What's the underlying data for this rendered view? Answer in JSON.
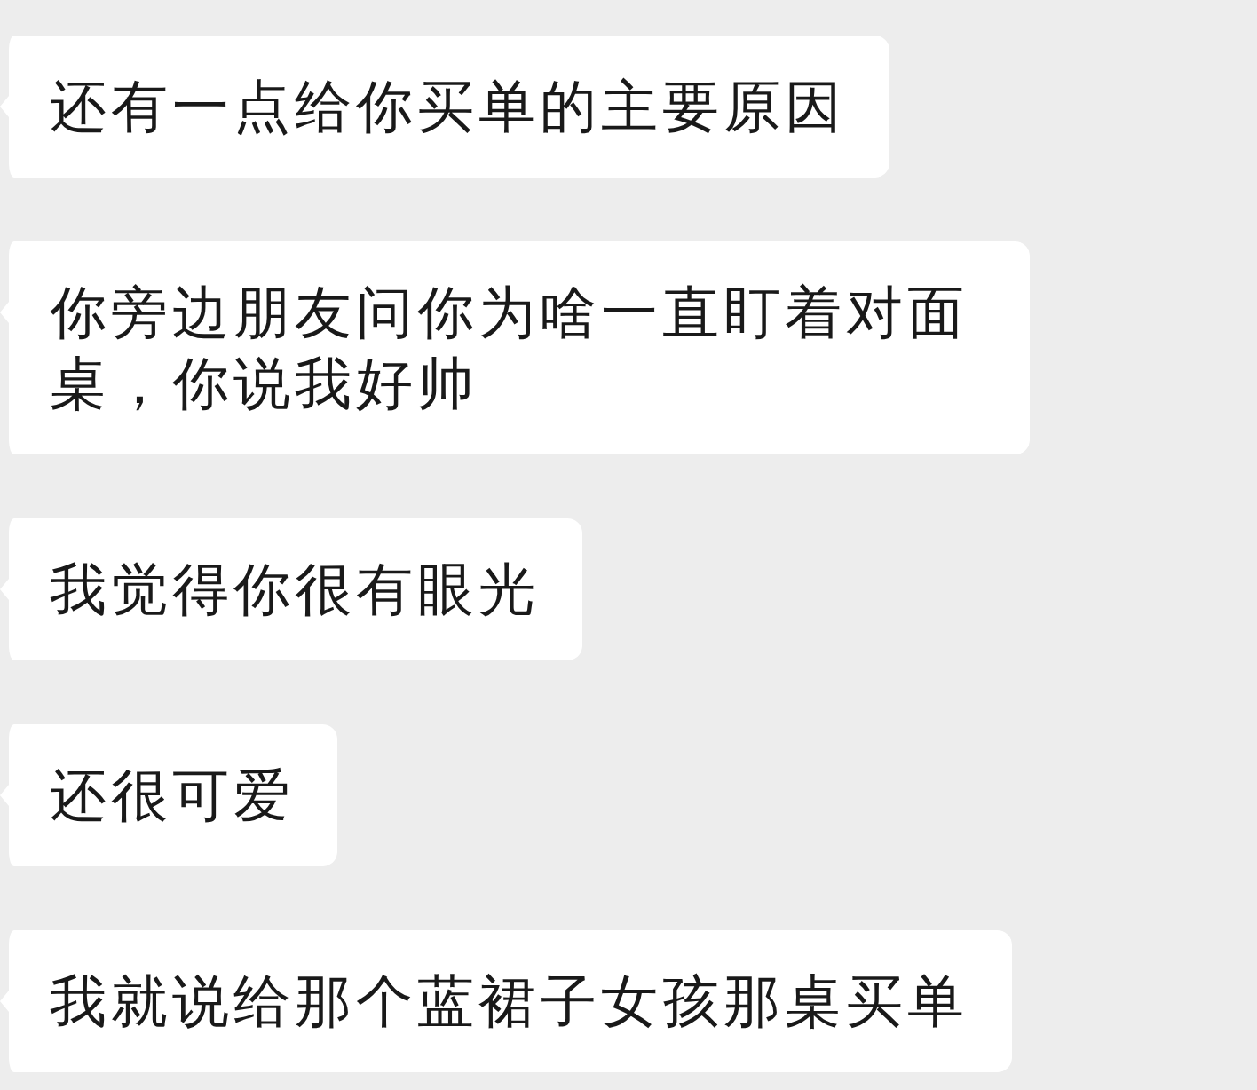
{
  "messages": [
    {
      "text": "还有一点给你买单的主要原因"
    },
    {
      "text": "你旁边朋友问你为啥一直盯着对面桌，你说我好帅"
    },
    {
      "text": "我觉得你很有眼光"
    },
    {
      "text": "还很可爱"
    },
    {
      "text": "我就说给那个蓝裙子女孩那桌买单"
    }
  ]
}
